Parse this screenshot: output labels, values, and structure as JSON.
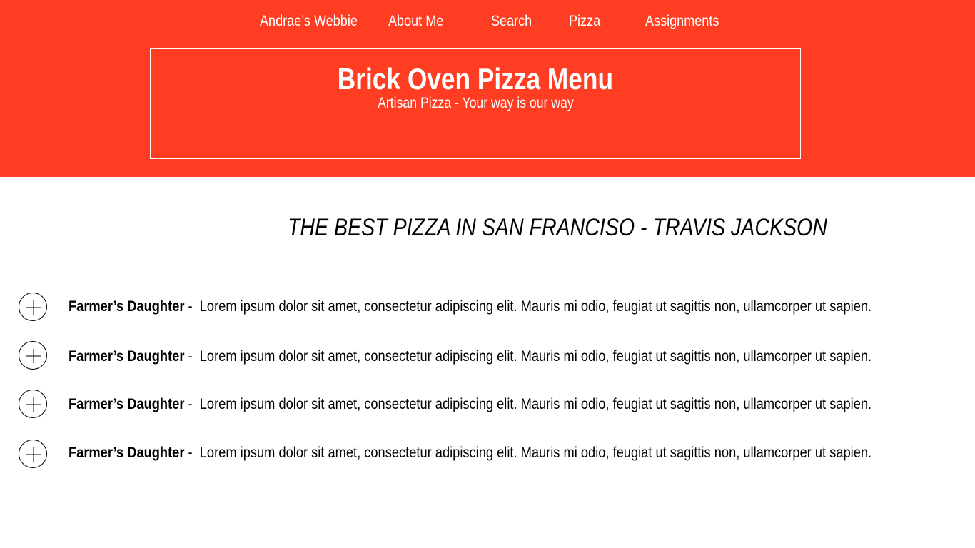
{
  "nav": {
    "items": [
      {
        "label": "Andrae’s Webbie"
      },
      {
        "label": "About Me"
      },
      {
        "label": "Search"
      },
      {
        "label": "Pizza"
      },
      {
        "label": "Assignments"
      }
    ]
  },
  "hero": {
    "title": "Brick Oven Pizza Menu",
    "subtitle": "Artisan Pizza - Your way is our way"
  },
  "section": {
    "title": "THE BEST PIZZA IN SAN FRANCISO - TRAVIS JACKSON"
  },
  "menu": {
    "items": [
      {
        "name": "Farmer’s Daughter",
        "separator": " -  ",
        "description": "Lorem ipsum dolor sit amet, consectetur adipiscing elit. Mauris mi odio, feugiat ut sagittis non, ullamcorper ut sapien."
      },
      {
        "name": "Farmer’s Daughter",
        "separator": " -  ",
        "description": "Lorem ipsum dolor sit amet, consectetur adipiscing elit. Mauris mi odio, feugiat ut sagittis non, ullamcorper ut sapien."
      },
      {
        "name": "Farmer’s Daughter",
        "separator": " -  ",
        "description": "Lorem ipsum dolor sit amet, consectetur adipiscing elit. Mauris mi odio, feugiat ut sagittis non, ullamcorper ut sapien."
      },
      {
        "name": "Farmer’s Daughter",
        "separator": " -  ",
        "description": "Lorem ipsum dolor sit amet, consectetur adipiscing elit. Mauris mi odio, feugiat ut sagittis non, ullamcorper ut sapien."
      }
    ],
    "expand_icon": "plus-circle-icon"
  },
  "colors": {
    "header_bg": "#ff3d22",
    "header_text": "#ffffff",
    "body_bg": "#ffffff",
    "body_text": "#000000"
  }
}
